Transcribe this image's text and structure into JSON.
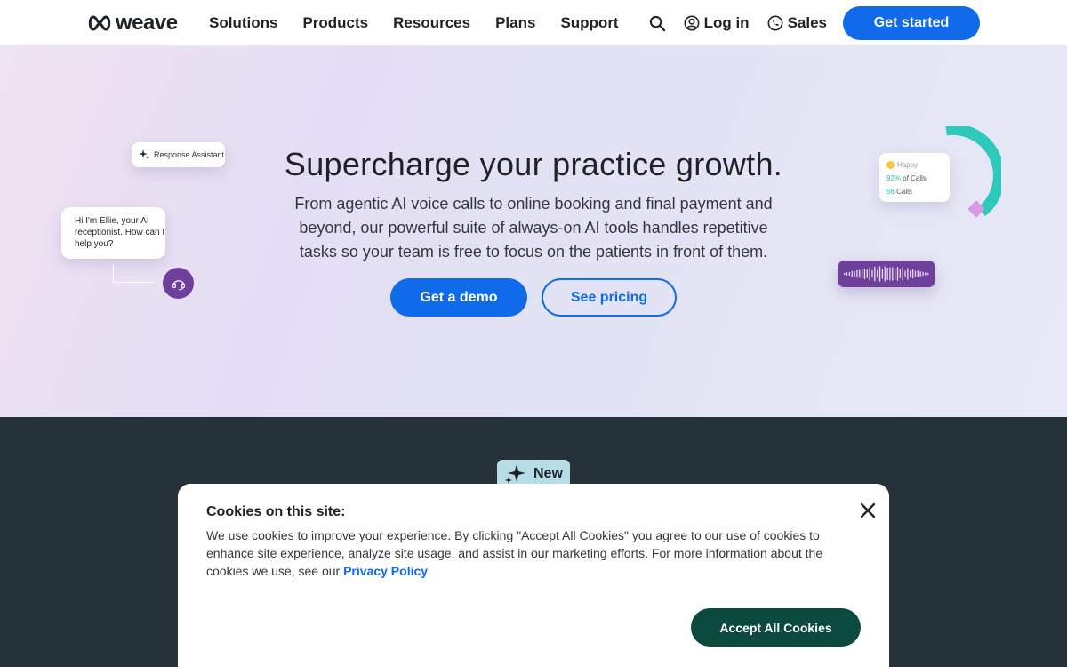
{
  "nav": {
    "logo_text": "weave",
    "links": [
      "Solutions",
      "Products",
      "Resources",
      "Plans",
      "Support"
    ],
    "login_label": "Log in",
    "sales_label": "Sales",
    "get_started_label": "Get started"
  },
  "hero": {
    "title": "Supercharge your practice growth.",
    "subtitle": "From agentic AI voice calls to online booking and final payment and beyond, our powerful suite of always-on AI tools handles repetitive tasks so your team is free to focus on the patients in front of them.",
    "demo_label": "Get a demo",
    "pricing_label": "See pricing",
    "response_assistant_label": "Response Assistant",
    "ellie_message": "Hi I'm Ellie, your AI receptionist. How can I help you?",
    "happy_card": {
      "label": "Happy",
      "pct_value": "92%",
      "pct_text": "of Calls",
      "count_value": "56",
      "count_text": "Calls"
    }
  },
  "promo": {
    "badge_label": "New"
  },
  "cookie": {
    "title": "Cookies on this site:",
    "text": "We use cookies to improve your experience. By clicking \"Accept All Cookies\" you agree to our use of cookies to enhance site experience, analyze site usage, and assist in our marketing efforts. For more information about the cookies we use, see our",
    "link_label": "Privacy Policy",
    "accept_label": "Accept All Cookies"
  },
  "colors": {
    "primary": "#0f6bea",
    "dark_bg": "#26323a",
    "accept_bg": "#0c4a3f",
    "purple": "#6e3f9b",
    "teal": "#25bfb3"
  }
}
